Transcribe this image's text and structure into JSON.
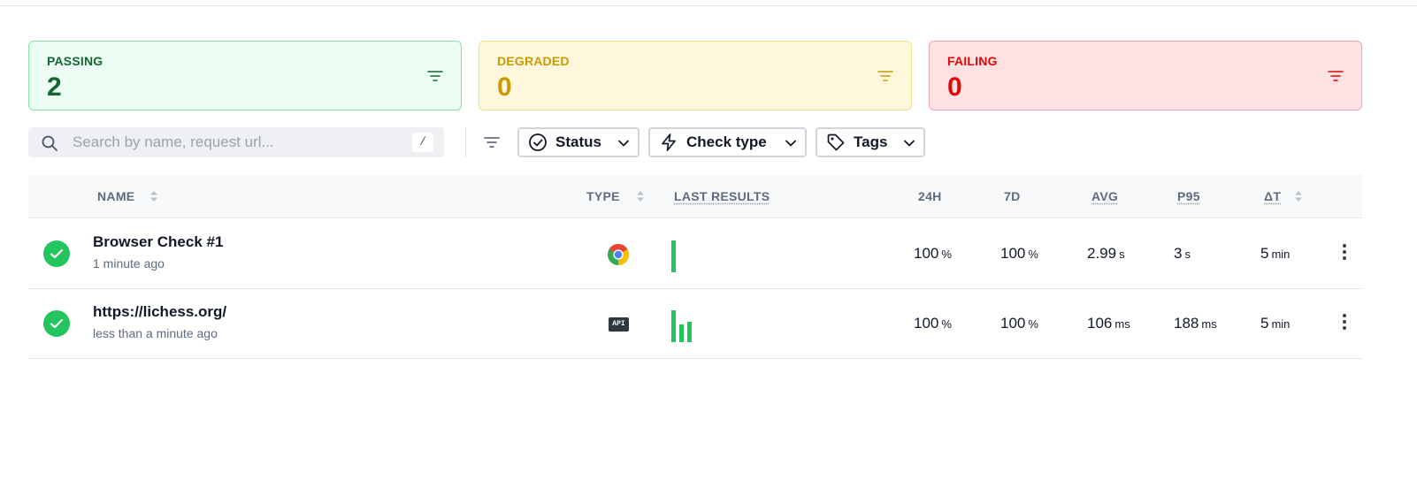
{
  "summary": {
    "passing": {
      "label": "PASSING",
      "count": "2",
      "color": "#166534"
    },
    "degraded": {
      "label": "DEGRADED",
      "count": "0",
      "color": "#ca9a04"
    },
    "failing": {
      "label": "FAILING",
      "count": "0",
      "color": "#dc0a0a"
    }
  },
  "toolbar": {
    "search_placeholder": "Search by name, request url...",
    "search_shortcut": "/",
    "filters": {
      "status": "Status",
      "check_type": "Check type",
      "tags": "Tags"
    }
  },
  "table": {
    "columns": {
      "name": "NAME",
      "type": "TYPE",
      "last_results": "LAST RESULTS",
      "h24": "24H",
      "d7": "7D",
      "avg": "AVG",
      "p95": "P95",
      "delta_t": "ΔT"
    },
    "rows": [
      {
        "status": "passing",
        "name": "Browser Check #1",
        "updated": "1 minute ago",
        "type": "chrome-icon",
        "last_results": [
          1.0
        ],
        "h24": {
          "value": "100",
          "unit": "%"
        },
        "d7": {
          "value": "100",
          "unit": "%"
        },
        "avg": {
          "value": "2.99",
          "unit": "s"
        },
        "p95": {
          "value": "3",
          "unit": "s"
        },
        "delta_t": {
          "value": "5",
          "unit": "min"
        }
      },
      {
        "status": "passing",
        "name": "https://lichess.org/",
        "updated": "less than a minute ago",
        "type": "api-icon",
        "type_label": "API",
        "last_results": [
          1.0,
          0.55,
          0.65
        ],
        "h24": {
          "value": "100",
          "unit": "%"
        },
        "d7": {
          "value": "100",
          "unit": "%"
        },
        "avg": {
          "value": "106",
          "unit": "ms"
        },
        "p95": {
          "value": "188",
          "unit": "ms"
        },
        "delta_t": {
          "value": "5",
          "unit": "min"
        }
      }
    ]
  }
}
